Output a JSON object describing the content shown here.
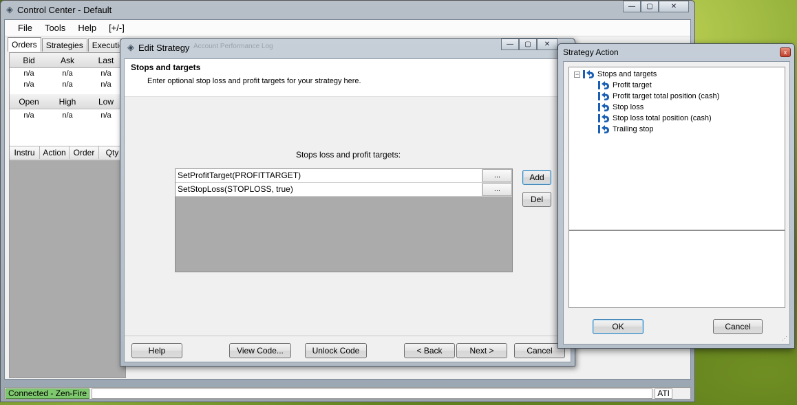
{
  "control_center": {
    "title": "Control Center - Default",
    "menu": [
      "File",
      "Tools",
      "Help",
      "[+/-]"
    ],
    "tabs": [
      "Orders",
      "Strategies",
      "Executions"
    ],
    "quote_headers_1": [
      "Bid",
      "Ask",
      "Last"
    ],
    "quote_rows_1": [
      [
        "n/a",
        "n/a",
        "n/a"
      ],
      [
        "n/a",
        "n/a",
        "n/a"
      ]
    ],
    "quote_headers_2": [
      "Open",
      "High",
      "Low"
    ],
    "quote_rows_2": [
      [
        "n/a",
        "n/a",
        "n/a"
      ]
    ],
    "grid_headers": [
      "Instru",
      "Action",
      "Order",
      "Qty"
    ],
    "status": {
      "connection": "Connected - Zen-Fire",
      "right": "ATI"
    }
  },
  "edit_strategy": {
    "title": "Edit Strategy",
    "ghost_tabs": "Account Performance   Log",
    "heading": "Stops and targets",
    "description": "Enter optional stop loss and profit targets for your strategy here.",
    "list_label": "Stops loss and profit targets:",
    "entries": [
      {
        "text": "SetProfitTarget(PROFITTARGET)",
        "edit": "..."
      },
      {
        "text": "SetStopLoss(STOPLOSS, true)",
        "edit": "..."
      }
    ],
    "buttons": {
      "add": "Add",
      "del": "Del",
      "help": "Help",
      "view_code": "View Code...",
      "unlock_code": "Unlock Code",
      "back": "< Back",
      "next": "Next >",
      "cancel": "Cancel"
    }
  },
  "strategy_action": {
    "title": "Strategy Action",
    "close": "x",
    "tree": {
      "toggle": "−",
      "root": "Stops and targets",
      "children": [
        "Profit target",
        "Profit target total position (cash)",
        "Stop loss",
        "Stop loss total position (cash)",
        "Trailing stop"
      ]
    },
    "buttons": {
      "ok": "OK",
      "cancel": "Cancel"
    }
  },
  "window_controls": {
    "minimize": "—",
    "maximize": "▢",
    "close": "✕"
  },
  "colors": {
    "connected": "#7ec86e",
    "focus_border": "#3c7fb1",
    "node_icon": "#1a5fb4"
  }
}
